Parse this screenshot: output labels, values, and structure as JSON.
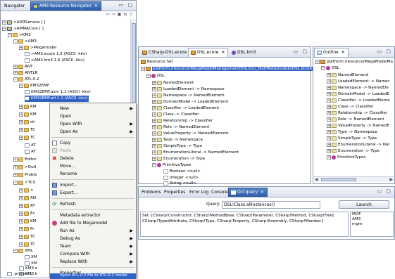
{
  "navigator": {
    "tabs": [
      {
        "label": "Navigator"
      },
      {
        "label": "AM3 Resource Navigator"
      }
    ],
    "rows": [
      {
        "label": ">AM3Service [              ]"
      },
      {
        "label": ">AMMACore [              ]"
      },
      {
        "label": ">KM3"
      },
      {
        "label": ">AM3"
      },
      {
        "label": ">Megamodel"
      },
      {
        "label": ">AM3.ecore 1.5 (ASCII -kkv)"
      },
      {
        "label": ">AM3.km3 1.6 (ASCII -kkv)"
      },
      {
        "label": "ANT"
      },
      {
        "label": "ANTLR"
      },
      {
        "label": "ATL-0.2"
      },
      {
        "label": "KM32EMF"
      },
      {
        "label": "KM32EMF.asm 1.1 (ASCII -kkv)"
      },
      {
        "label": "KM32EMF.atl 1.1 (ASCII -kkv)"
      },
      {
        "label": "KM"
      },
      {
        "label": "KM"
      },
      {
        "label": "sti"
      },
      {
        "label": "TC"
      },
      {
        "label": "TC"
      },
      {
        "label": "AT"
      },
      {
        "label": "AT"
      },
      {
        "label": "Editor"
      },
      {
        "label": ">Outl"
      },
      {
        "label": "Proble"
      },
      {
        "label": ">TCS"
      },
      {
        "label": ">"
      },
      {
        "label": "AN"
      },
      {
        "label": "AT"
      },
      {
        "label": "Ec"
      },
      {
        "label": "KM"
      },
      {
        "label": "Pr"
      },
      {
        "label": "TC"
      },
      {
        "label": "TC"
      },
      {
        "label": "XML"
      },
      {
        "label": "XM"
      },
      {
        "label": "XM"
      },
      {
        "label": "KM3.e"
      },
      {
        "label": "KM3.k"
      },
      {
        "label": ".project 1"
      }
    ]
  },
  "context_menu": {
    "items": [
      {
        "label": "New"
      },
      {
        "label": "Open"
      },
      {
        "label": "Open With"
      },
      {
        "label": "Open As"
      },
      {
        "label": "Copy"
      },
      {
        "label": "Paste"
      },
      {
        "label": "Delete"
      },
      {
        "label": "Move..."
      },
      {
        "label": "Rename"
      },
      {
        "label": "Import..."
      },
      {
        "label": "Export..."
      },
      {
        "label": "Refresh"
      },
      {
        "label": "Metadata extractor"
      },
      {
        "label": "Add file to Megamodel"
      },
      {
        "label": "Run As"
      },
      {
        "label": "Debug As"
      },
      {
        "label": "Team"
      },
      {
        "label": "Compare With"
      },
      {
        "label": "Replace With"
      },
      {
        "label": "Properties"
      },
      {
        "label": "Inject ATL-0.2 file to ATL-0.2 model"
      }
    ]
  },
  "editor": {
    "tabs": [
      {
        "label": "CSharp-DSL.ecore"
      },
      {
        "label": "DSL.ecore"
      },
      {
        "label": "DSL.km3"
      }
    ],
    "resource_set_label": "Resource Set",
    "resource_uri": "platform:/resource/MegaModelManagement/DSLZoo_Test/Metamodels/DSL.ecore",
    "rows": [
      {
        "label": "DSL"
      },
      {
        "label": "NamedElement"
      },
      {
        "label": "LoadedElement -> Namespace"
      },
      {
        "label": "Namespace -> NamedElement"
      },
      {
        "label": "DomainModel -> LoadedElement"
      },
      {
        "label": "Classifier -> LoadedElement"
      },
      {
        "label": "Class -> Classifier"
      },
      {
        "label": "Relationship -> Classifier"
      },
      {
        "label": "Role -> NamedElement"
      },
      {
        "label": "ValueProperty -> NamedElement"
      },
      {
        "label": "Type -> Namespace"
      },
      {
        "label": "SimpleType -> Type"
      },
      {
        "label": "EnumerationLiteral -> NamedElement"
      },
      {
        "label": "Enumeration -> Type"
      },
      {
        "label": "PrimitiveTypes"
      },
      {
        "label": "Boolean <null>"
      },
      {
        "label": "Integer <null>"
      },
      {
        "label": "String <null>"
      }
    ]
  },
  "outline": {
    "tab": "Outline",
    "rows": [
      {
        "label": "platform:/resource/MegaModelMa"
      },
      {
        "label": "DSL"
      },
      {
        "label": "NamedElement"
      },
      {
        "label": "LoadedElement -> Names"
      },
      {
        "label": "Namespace -> NamedEle"
      },
      {
        "label": "DomainModel -> LoadedE"
      },
      {
        "label": "Classifier -> LoadedEleme"
      },
      {
        "label": "Class -> Classifier"
      },
      {
        "label": "Relationship -> Classifier"
      },
      {
        "label": "Role -> NamedElement"
      },
      {
        "label": "ValueProperty -> NamedE"
      },
      {
        "label": "Type -> Namespace"
      },
      {
        "label": "SimpleType -> Type"
      },
      {
        "label": "EnumerationLiteral -> Nar"
      },
      {
        "label": "Enumeration -> Type"
      },
      {
        "label": "PrimitiveTypes"
      }
    ]
  },
  "bottom": {
    "tabs": [
      {
        "label": "Problems"
      },
      {
        "label": "Properties"
      },
      {
        "label": "Error Log"
      },
      {
        "label": "Console"
      },
      {
        "label": "Ocl query"
      }
    ],
    "query_label": "Query:",
    "query_value": "DSL!Class.allInstances()",
    "launch_label": "Launch",
    "result_text": "Set {CSharp!Constructor, CSharp!MethodBase, CSharp!Parameter, CSharp!Method, CSharp!Field, CSharp!TypedAttribute, CSharp!Type, CSharp!Property, CSharp!Assembly, CSharp!Member}",
    "models": [
      {
        "label": "MOF"
      },
      {
        "label": "AM3"
      },
      {
        "label": "mgm"
      }
    ]
  }
}
